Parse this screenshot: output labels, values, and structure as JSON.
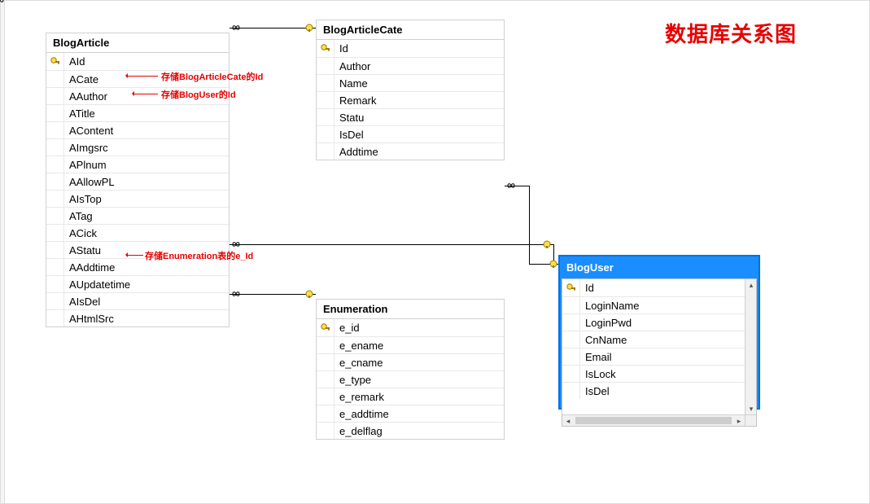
{
  "title": "数据库关系图",
  "tables": {
    "blogArticle": {
      "name": "BlogArticle",
      "cols": [
        {
          "k": true,
          "n": "AId"
        },
        {
          "k": false,
          "n": "ACate"
        },
        {
          "k": false,
          "n": "AAuthor"
        },
        {
          "k": false,
          "n": "ATitle"
        },
        {
          "k": false,
          "n": "AContent"
        },
        {
          "k": false,
          "n": "AImgsrc"
        },
        {
          "k": false,
          "n": "APlnum"
        },
        {
          "k": false,
          "n": "AAllowPL"
        },
        {
          "k": false,
          "n": "AIsTop"
        },
        {
          "k": false,
          "n": "ATag"
        },
        {
          "k": false,
          "n": "ACick"
        },
        {
          "k": false,
          "n": "AStatu"
        },
        {
          "k": false,
          "n": "AAddtime"
        },
        {
          "k": false,
          "n": "AUpdatetime"
        },
        {
          "k": false,
          "n": "AIsDel"
        },
        {
          "k": false,
          "n": "AHtmlSrc"
        }
      ]
    },
    "blogArticleCate": {
      "name": "BlogArticleCate",
      "cols": [
        {
          "k": true,
          "n": "Id"
        },
        {
          "k": false,
          "n": "Author"
        },
        {
          "k": false,
          "n": "Name"
        },
        {
          "k": false,
          "n": "Remark"
        },
        {
          "k": false,
          "n": "Statu"
        },
        {
          "k": false,
          "n": "IsDel"
        },
        {
          "k": false,
          "n": "Addtime"
        }
      ]
    },
    "enumeration": {
      "name": "Enumeration",
      "cols": [
        {
          "k": true,
          "n": "e_id"
        },
        {
          "k": false,
          "n": "e_ename"
        },
        {
          "k": false,
          "n": "e_cname"
        },
        {
          "k": false,
          "n": "e_type"
        },
        {
          "k": false,
          "n": "e_remark"
        },
        {
          "k": false,
          "n": "e_addtime"
        },
        {
          "k": false,
          "n": "e_delflag"
        }
      ]
    },
    "blogUser": {
      "name": "BlogUser",
      "cols": [
        {
          "k": true,
          "n": "Id"
        },
        {
          "k": false,
          "n": "LoginName"
        },
        {
          "k": false,
          "n": "LoginPwd"
        },
        {
          "k": false,
          "n": "CnName"
        },
        {
          "k": false,
          "n": "Email"
        },
        {
          "k": false,
          "n": "IsLock"
        },
        {
          "k": false,
          "n": "IsDel"
        }
      ]
    }
  },
  "annotations": {
    "acate": "存储BlogArticleCate的Id",
    "aauthor": "存储BlogUser的Id",
    "astatu": "存储Enumeration表的e_Id"
  }
}
